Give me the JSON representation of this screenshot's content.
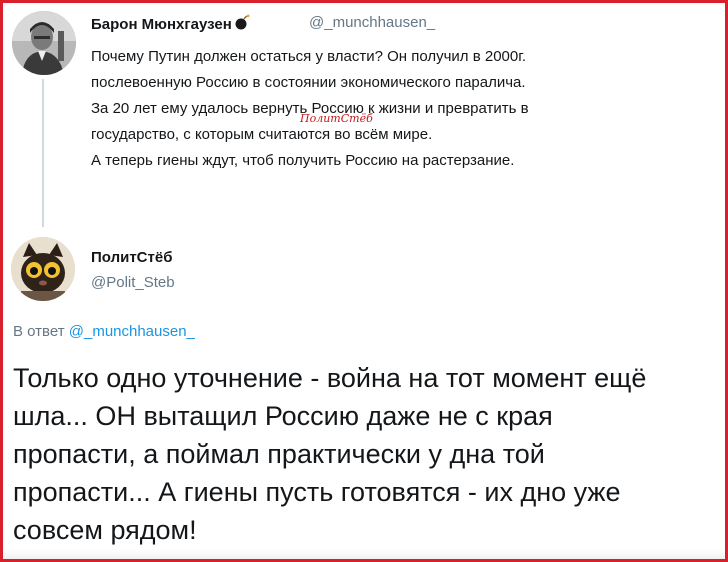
{
  "colors": {
    "frame": "#d9202a",
    "text": "#14171a",
    "muted": "#657786",
    "link": "#1b95e0",
    "watermark": "#c2181f"
  },
  "parent_tweet": {
    "author_name": "Барон Мюнхгаузен",
    "author_badge_icon": "bomb-icon",
    "author_handle": "@_munchhausen_",
    "lines": [
      "Почему Путин должен остаться у власти? Он получил в 2000г.",
      "послевоенную Россию в состоянии экономического паралича.",
      "За 20 лет ему удалось вернуть Россию к жизни и превратить в",
      "государство, с которым считаются во всём мире.",
      "А теперь гиены ждут, чтоб получить Россию на растерзание."
    ]
  },
  "watermark": "ПолитСтёб",
  "reply_tweet": {
    "author_name": "ПолитСтёб",
    "author_handle": "@Polit_Steb",
    "reply_prefix": "В ответ",
    "reply_to_handle": "@_munchhausen_",
    "lines": [
      "Только одно уточнение - война на тот момент ещё",
      "шла... ОН вытащил Россию даже не с края",
      "пропасти, а поймал практически у дна той",
      "пропасти... А гиены пусть готовятся - их дно уже",
      "совсем рядом!"
    ]
  }
}
